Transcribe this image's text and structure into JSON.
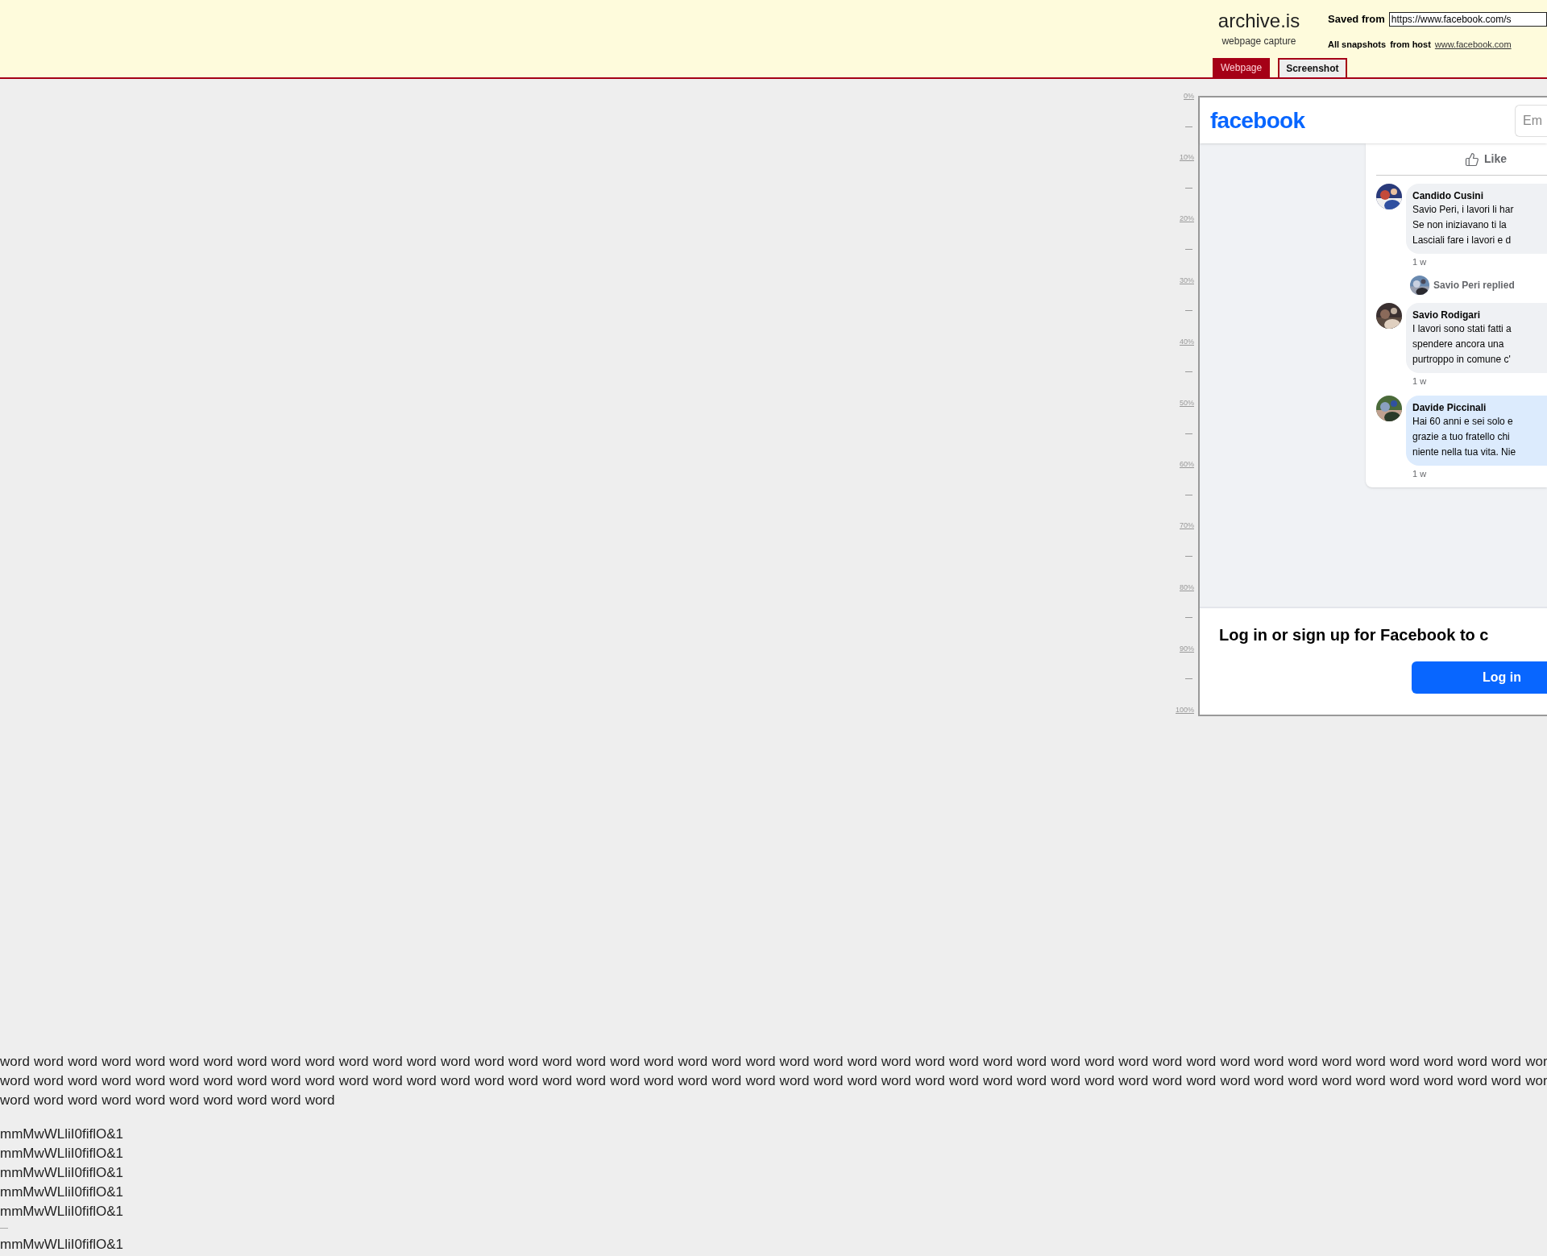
{
  "header": {
    "logo": "archive.is",
    "tagline": "webpage capture",
    "saved_from_label": "Saved from",
    "url": "https://www.facebook.com/s",
    "all_snapshots": "All snapshots",
    "from_host_label": "from host",
    "host_link": "www.facebook.com"
  },
  "tabs": [
    {
      "label": "Webpage",
      "selected": false
    },
    {
      "label": "Screenshot",
      "selected": true
    }
  ],
  "ruler": [
    "0%",
    "10%",
    "20%",
    "30%",
    "40%",
    "50%",
    "60%",
    "70%",
    "80%",
    "90%",
    "100%"
  ],
  "screenshot": {
    "logo": "facebook",
    "email_placeholder": "Em",
    "like": "Like",
    "thread": [
      {
        "kind": "comment",
        "author": "Candido Cusini",
        "lines": [
          "Savio Peri, i lavori li har",
          "Se non iniziavano ti la",
          "Lasciali fare i lavori e d"
        ],
        "time": "1 w",
        "highlighted": false
      },
      {
        "kind": "replies",
        "text": "Savio Peri replied"
      },
      {
        "kind": "comment",
        "author": "Savio Rodigari",
        "lines": [
          "I lavori sono stati fatti a",
          "spendere ancora una",
          "purtroppo in comune c'"
        ],
        "time": "1 w",
        "highlighted": false
      },
      {
        "kind": "comment",
        "author": "Davide Piccinali",
        "lines": [
          "Hai 60 anni e sei solo e",
          "grazie a tuo fratello chi",
          "niente nella tua vita. Nie"
        ],
        "time": "1 w",
        "highlighted": true
      }
    ],
    "login_prompt": "Log in or sign up for Facebook to c",
    "login_button": "Log in"
  },
  "sample_text": {
    "paragraph_lines": [
      "word word word word word word word word word word word word word word word word word word word word word word word word word word word word word word word word word word word word word word word word word word word word word wor",
      "word word word word word word word word word word word word word word word word word word word word word word word word word word word word word word word word word word word word word word word word word word word word word wor",
      "word word word word word word word word word word"
    ],
    "glyph_lines": [
      "mmMwWLliI0fiflO&1",
      "mmMwWLliI0fiflO&1",
      "mmMwWLliI0fiflO&1",
      "mmMwWLliI0fiflO&1",
      "mmMwWLliI0fiflO&1"
    ],
    "glyph_after": "mmMwWLliI0fiflO&1"
  }
}
